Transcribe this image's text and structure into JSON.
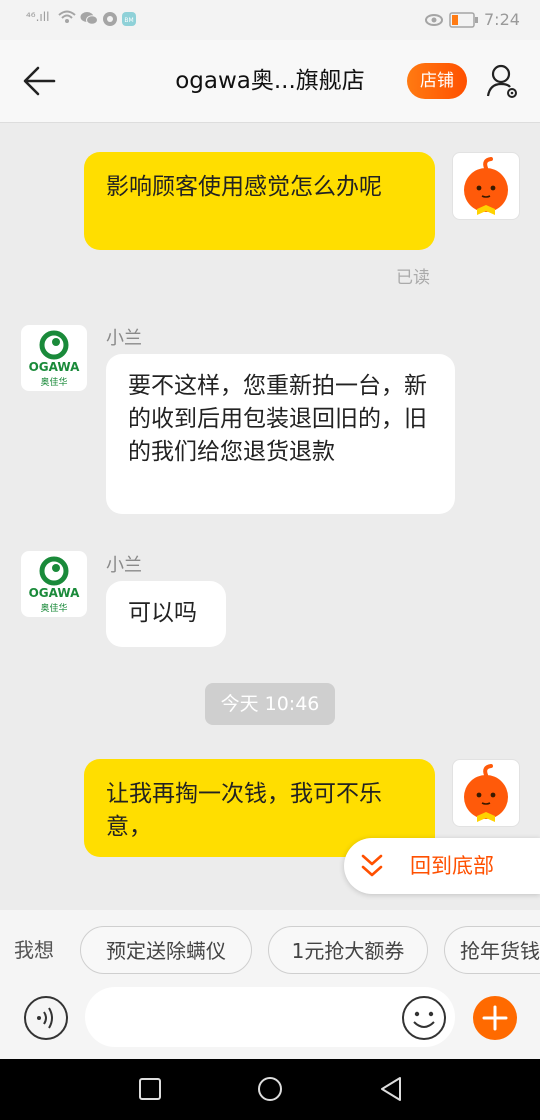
{
  "status_bar": {
    "left_text": "⁴⁶.ıll",
    "time": "7:24",
    "icons": [
      "signal-icon",
      "wifi-icon",
      "wechat-icon",
      "notification-icon",
      "app-icon",
      "eye-icon",
      "battery-icon"
    ]
  },
  "header": {
    "title": "ogawa奥...旗舰店",
    "shop_button": "店铺",
    "icons": [
      "back-arrow-icon",
      "user-settings-icon"
    ]
  },
  "messages": [
    {
      "from": "self",
      "text": "影响顾客使用感觉怎么办呢",
      "status": "已读"
    },
    {
      "from": "shop",
      "sender": "小兰",
      "text": "要不这样，您重新拍一台，新的收到后用包装退回旧的，旧的我们给您退货退款"
    },
    {
      "from": "shop",
      "sender": "小兰",
      "text": "可以吗"
    },
    {
      "type": "time",
      "text": "今天 10:46"
    },
    {
      "from": "self",
      "text": "让我再掏一次钱，我可不乐意，"
    }
  ],
  "brand_avatar": {
    "name": "OGAWA",
    "subname": "奥佳华",
    "color": "#1a8a3a"
  },
  "back_to_bottom": "回到底部",
  "quick_replies": {
    "label": "我想",
    "items": [
      "预定送除螨仪",
      "1元抢大额券",
      "抢年货钱"
    ]
  },
  "input": {
    "value": "",
    "placeholder": ""
  },
  "accent_colors": {
    "orange": "#ff5000",
    "bubble_yellow": "#ffde00"
  }
}
